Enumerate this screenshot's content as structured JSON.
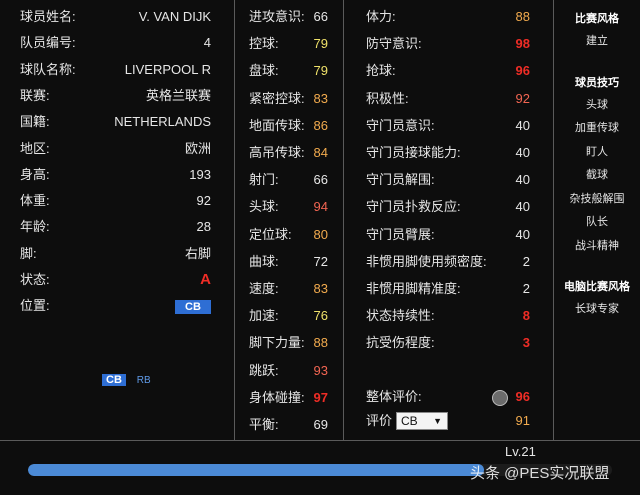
{
  "profile": [
    {
      "label": "球员姓名:",
      "value": "V. VAN DIJK"
    },
    {
      "label": "队员编号:",
      "value": "4"
    },
    {
      "label": "球队名称:",
      "value": "LIVERPOOL R"
    },
    {
      "label": "联赛:",
      "value": "英格兰联赛"
    },
    {
      "label": "国籍:",
      "value": "NETHERLANDS"
    },
    {
      "label": "地区:",
      "value": "欧洲"
    },
    {
      "label": "身高:",
      "value": "193"
    },
    {
      "label": "体重:",
      "value": "92"
    },
    {
      "label": "年龄:",
      "value": "28"
    },
    {
      "label": "脚:",
      "value": "右脚"
    },
    {
      "label": "状态:",
      "value": "A"
    },
    {
      "label": "位置:",
      "value": "CB"
    }
  ],
  "positions_minimap": {
    "primary": "CB",
    "secondary": "RB"
  },
  "stats_col1": [
    {
      "label": "进攻意识:",
      "value": "66"
    },
    {
      "label": "控球:",
      "value": "79"
    },
    {
      "label": "盘球:",
      "value": "79"
    },
    {
      "label": "紧密控球:",
      "value": "83"
    },
    {
      "label": "地面传球:",
      "value": "86"
    },
    {
      "label": "高吊传球:",
      "value": "84"
    },
    {
      "label": "射门:",
      "value": "66"
    },
    {
      "label": "头球:",
      "value": "94"
    },
    {
      "label": "定位球:",
      "value": "80"
    },
    {
      "label": "曲球:",
      "value": "72"
    },
    {
      "label": "速度:",
      "value": "83"
    },
    {
      "label": "加速:",
      "value": "76"
    },
    {
      "label": "脚下力量:",
      "value": "88"
    },
    {
      "label": "跳跃:",
      "value": "93"
    },
    {
      "label": "身体碰撞:",
      "value": "97"
    },
    {
      "label": "平衡:",
      "value": "69"
    }
  ],
  "stats_col2": [
    {
      "label": "体力:",
      "value": "88"
    },
    {
      "label": "防守意识:",
      "value": "98"
    },
    {
      "label": "抢球:",
      "value": "96"
    },
    {
      "label": "积极性:",
      "value": "92"
    },
    {
      "label": "守门员意识:",
      "value": "40"
    },
    {
      "label": "守门员接球能力:",
      "value": "40"
    },
    {
      "label": "守门员解围:",
      "value": "40"
    },
    {
      "label": "守门员扑救反应:",
      "value": "40"
    },
    {
      "label": "守门员臂展:",
      "value": "40"
    },
    {
      "label": "非惯用脚使用频密度:",
      "value": "2"
    },
    {
      "label": "非惯用脚精准度:",
      "value": "2"
    },
    {
      "label": "状态持续性:",
      "value": "8"
    },
    {
      "label": "抗受伤程度:",
      "value": "3"
    }
  ],
  "overall": {
    "label": "整体评价:",
    "value": "96"
  },
  "rating": {
    "label": "评价",
    "select_value": "CB",
    "value": "91"
  },
  "level": "Lv.21",
  "progress_fraction": 0.78,
  "watermark": "头条 @PES实况联盟",
  "sidebar": {
    "sections": [
      {
        "title": "比赛风格",
        "items": [
          "建立"
        ]
      },
      {
        "title": "球员技巧",
        "items": [
          "头球",
          "加重传球",
          "盯人",
          "截球",
          "杂技般解围",
          "队长",
          "战斗精神"
        ]
      },
      {
        "title": "电脑比赛风格",
        "items": [
          "长球专家"
        ]
      }
    ]
  },
  "colors": {
    "red": "#ef2d26",
    "orange": "#f2ab4e",
    "yellow": "#f0e26a",
    "white": "#e6e6e6",
    "blue": "#2e6ed4",
    "progress": "#4b8ad6"
  }
}
